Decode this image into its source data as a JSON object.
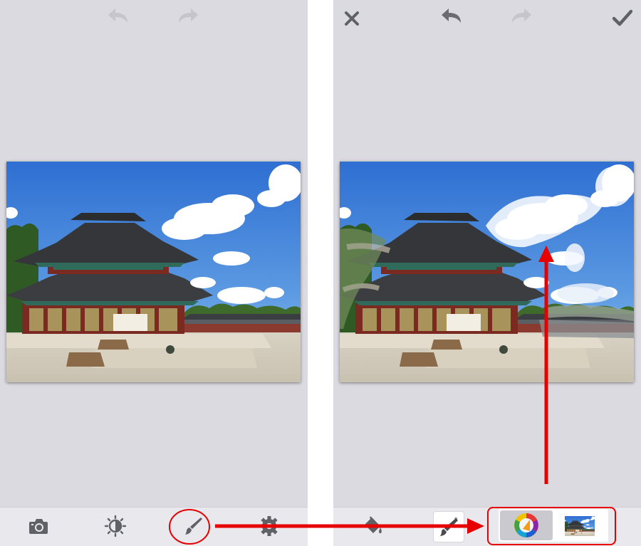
{
  "left_screen": {
    "top_bar": {
      "undo_icon": "undo-arrow-icon",
      "redo_icon": "redo-arrow-icon"
    },
    "photo": {
      "subject": "photo-palace"
    },
    "toolbar": {
      "icons": [
        "camera-icon",
        "brightness-icon",
        "paintbrush-icon",
        "gear-icon"
      ]
    }
  },
  "right_screen": {
    "top_bar": {
      "icons": [
        "close-icon",
        "undo-arrow-icon",
        "redo-arrow-icon",
        "checkmark-icon"
      ]
    },
    "photo": {
      "subject": "photo-palace-painted"
    },
    "toolbar": {
      "icons": [
        "paint-bucket-icon",
        "brush-pen-icon",
        "color-wheel-icon",
        "photo-thumbnail-icon"
      ]
    }
  },
  "annotations": {
    "highlight_color": "#e60000",
    "callouts": [
      "circle-around-paintbrush",
      "box-around-color-and-source",
      "arrow-to-toolbar",
      "arrow-to-painted-cloud"
    ]
  }
}
